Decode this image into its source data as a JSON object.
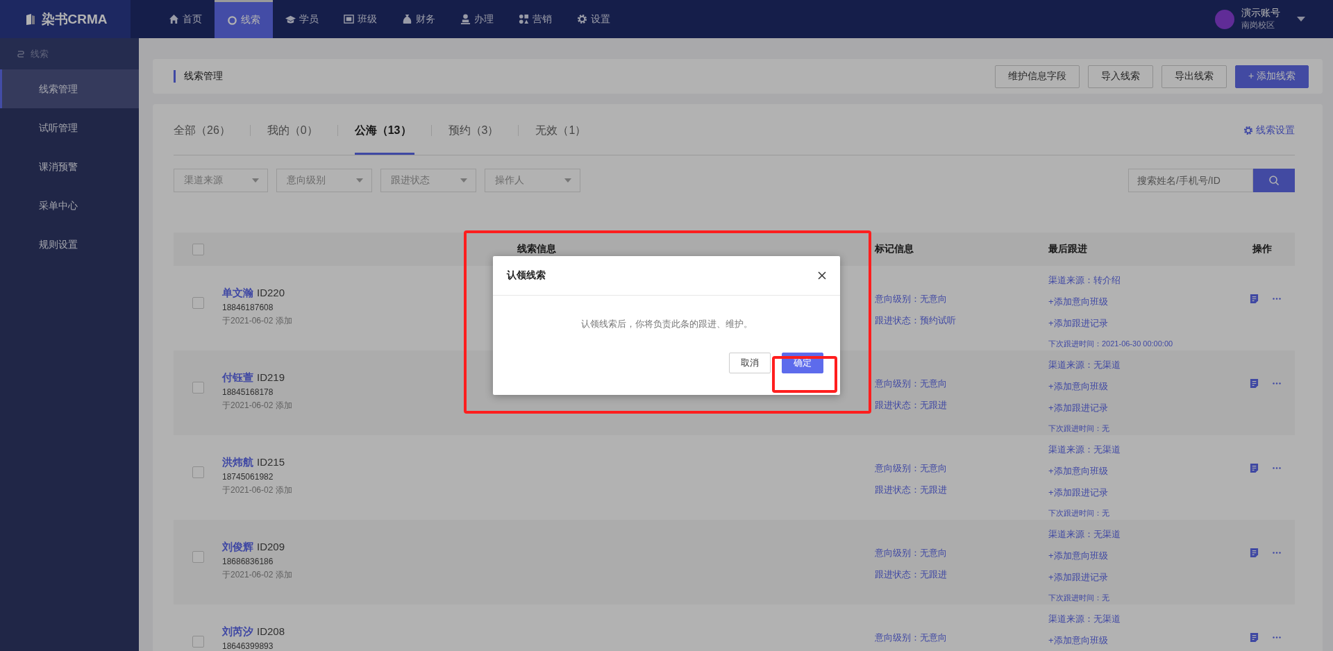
{
  "nav": {
    "brand": "染书CRMA",
    "items": [
      {
        "label": "首页",
        "selected": false
      },
      {
        "label": "线索",
        "selected": true
      },
      {
        "label": "学员",
        "selected": false
      },
      {
        "label": "班级",
        "selected": false
      },
      {
        "label": "财务",
        "selected": false
      },
      {
        "label": "办理",
        "selected": false
      },
      {
        "label": "营销",
        "selected": false
      },
      {
        "label": "设置",
        "selected": false
      }
    ],
    "user": {
      "name": "演示账号",
      "campus": "南岗校区"
    }
  },
  "sidebar": {
    "header": "线索",
    "items": [
      {
        "label": "线索管理",
        "selected": true
      },
      {
        "label": "试听管理",
        "selected": false
      },
      {
        "label": "课消预警",
        "selected": false
      },
      {
        "label": "采单中心",
        "selected": false
      },
      {
        "label": "规则设置",
        "selected": false
      }
    ]
  },
  "page_header": {
    "title": "线索管理",
    "buttons": [
      {
        "label": "维护信息字段",
        "kind": "default"
      },
      {
        "label": "导入线索",
        "kind": "default"
      },
      {
        "label": "导出线索",
        "kind": "default"
      },
      {
        "label": "+ 添加线索",
        "kind": "primary"
      }
    ]
  },
  "tabs": [
    {
      "label": "全部（26）",
      "selected": false
    },
    {
      "label": "我的（0）",
      "selected": false
    },
    {
      "label": "公海（13）",
      "selected": true
    },
    {
      "label": "预约（3）",
      "selected": false
    },
    {
      "label": "无效（1）",
      "selected": false
    }
  ],
  "settings_link": "线索设置",
  "filters": [
    {
      "placeholder": "渠道来源"
    },
    {
      "placeholder": "意向级别"
    },
    {
      "placeholder": "跟进状态"
    },
    {
      "placeholder": "操作人"
    }
  ],
  "search": {
    "placeholder": "搜索姓名/手机号/ID"
  },
  "table": {
    "select_all": {
      "checked": false
    },
    "columns": [
      "线索信息",
      "标记信息",
      "最后跟进",
      "操作"
    ],
    "rows": [
      {
        "checked": false,
        "name": "单文瀚",
        "id": "ID220",
        "phone": "18846187608",
        "added": "于2021-06-02 添加",
        "marks": [
          "意向级别：无意向",
          "跟进状态：预约试听"
        ],
        "follow": [
          {
            "kind": "source",
            "text": "渠道来源：转介绍"
          },
          {
            "kind": "action",
            "text": "+添加意向班级"
          },
          {
            "kind": "action",
            "text": "+添加跟进记录"
          },
          {
            "kind": "next",
            "text": "下次跟进时间：2021-06-30 00:00:00"
          }
        ]
      },
      {
        "checked": false,
        "name": "付钰萱",
        "id": "ID219",
        "phone": "18845168178",
        "added": "于2021-06-02 添加",
        "marks": [
          "意向级别：无意向",
          "跟进状态：无跟进"
        ],
        "follow": [
          {
            "kind": "source",
            "text": "渠道来源：无渠道"
          },
          {
            "kind": "action",
            "text": "+添加意向班级"
          },
          {
            "kind": "action",
            "text": "+添加跟进记录"
          },
          {
            "kind": "next",
            "text": "下次跟进时间：无"
          }
        ]
      },
      {
        "checked": false,
        "name": "洪炜航",
        "id": "ID215",
        "phone": "18745061982",
        "added": "于2021-06-02 添加",
        "marks": [
          "意向级别：无意向",
          "跟进状态：无跟进"
        ],
        "follow": [
          {
            "kind": "source",
            "text": "渠道来源：无渠道"
          },
          {
            "kind": "action",
            "text": "+添加意向班级"
          },
          {
            "kind": "action",
            "text": "+添加跟进记录"
          },
          {
            "kind": "next",
            "text": "下次跟进时间：无"
          }
        ]
      },
      {
        "checked": false,
        "name": "刘俊辉",
        "id": "ID209",
        "phone": "18686836186",
        "added": "于2021-06-02 添加",
        "marks": [
          "意向级别：无意向",
          "跟进状态：无跟进"
        ],
        "follow": [
          {
            "kind": "source",
            "text": "渠道来源：无渠道"
          },
          {
            "kind": "action",
            "text": "+添加意向班级"
          },
          {
            "kind": "action",
            "text": "+添加跟进记录"
          },
          {
            "kind": "next",
            "text": "下次跟进时间：无"
          }
        ]
      },
      {
        "checked": false,
        "name": "刘芮汐",
        "id": "ID208",
        "phone": "18646399893",
        "marks": [
          "意向级别：无意向"
        ],
        "follow": [
          {
            "kind": "source",
            "text": "渠道来源：无渠道"
          },
          {
            "kind": "action",
            "text": "+添加意向班级"
          }
        ]
      }
    ]
  },
  "dialog": {
    "title": "认领线索",
    "message": "认领线索后，你将负责此条的跟进、维护。",
    "buttons": [
      {
        "label": "取消",
        "kind": "default"
      },
      {
        "label": "确定",
        "kind": "primary"
      }
    ]
  }
}
